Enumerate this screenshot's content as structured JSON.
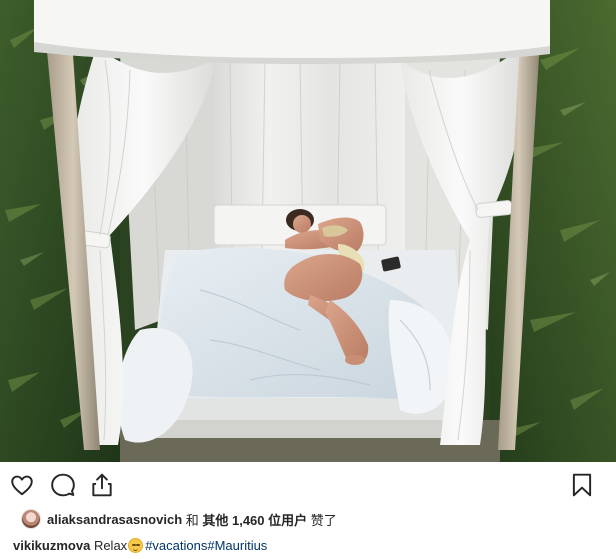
{
  "post": {
    "photo_alt": "",
    "actions": {
      "like_icon": "heart-outline-icon",
      "comment_icon": "speech-bubble-icon",
      "share_icon": "share-upload-icon",
      "save_icon": "bookmark-icon"
    },
    "likes": {
      "avatar_icon": "user-avatar",
      "username": "aliaksandrasasnovich",
      "connector": " 和 ",
      "others_label": "其他 1,460 位用户",
      "suffix": " 赞了"
    },
    "caption": {
      "username": "vikikuzmova",
      "text": " Relax",
      "emoji": "relieved-face-emoji",
      "hashtags": [
        "#vacations",
        "#Mauritius"
      ]
    }
  },
  "colors": {
    "text": "#262626",
    "hashtag": "#003569",
    "icon": "#262626"
  }
}
